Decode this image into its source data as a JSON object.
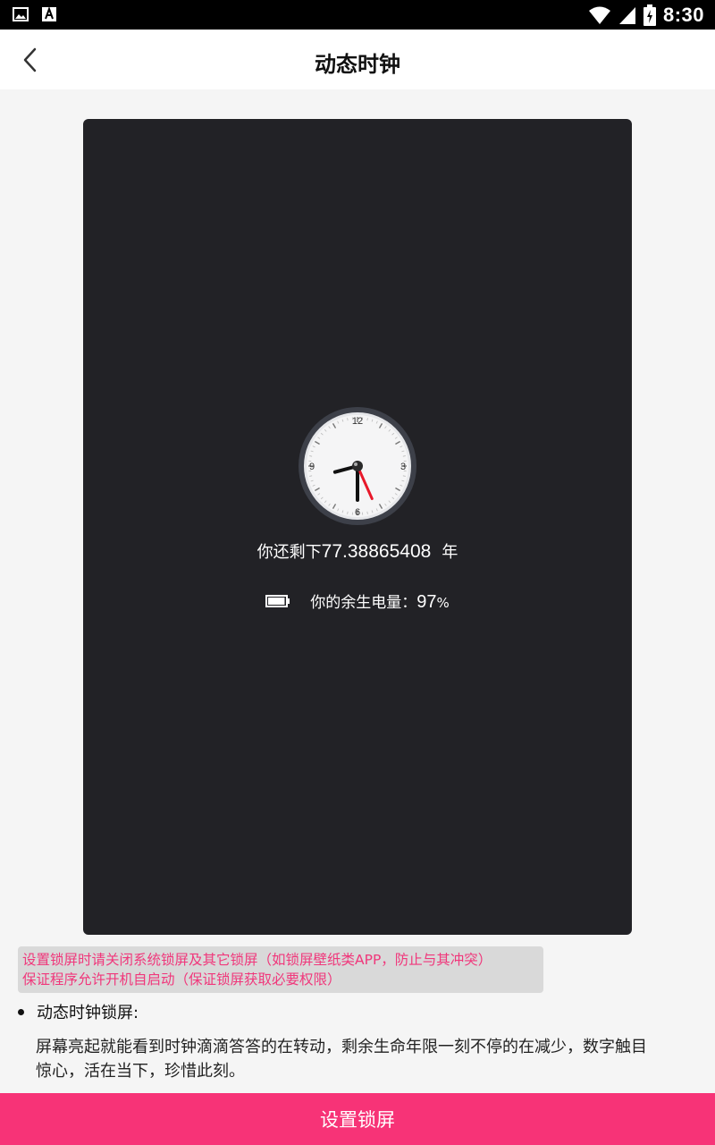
{
  "status_bar": {
    "time": "8:30",
    "left_icons": [
      "image-icon",
      "text-icon"
    ],
    "right_icons": [
      "wifi-icon",
      "signal-icon",
      "battery-charging-icon"
    ]
  },
  "app_bar": {
    "title": "动态时钟",
    "back_icon": "chevron-left-icon"
  },
  "preview": {
    "clock": {
      "numerals": [
        "12",
        "3",
        "6",
        "9"
      ],
      "hour": 8,
      "minute": 30,
      "second": 26
    },
    "remaining_prefix": "你还剩下",
    "remaining_years": "77.38865408",
    "remaining_unit": "年",
    "battery_label": "你的余生电量：",
    "battery_percent": "97",
    "battery_percent_sign": "%",
    "battery_level": 0.97
  },
  "notice": {
    "line1": "设置锁屏时请关闭系统锁屏及其它锁屏（如锁屏壁纸类APP，防止与其冲突）",
    "line2": "保证程序允许开机自启动（保证锁屏获取必要权限）"
  },
  "feature": {
    "title": "动态时钟锁屏:",
    "desc_line1": "屏幕亮起就能看到时钟滴滴答答的在转动，剩余生命年限一刻不停的在减少，数字触目",
    "desc_line2": "惊心，活在当下，珍惜此刻。"
  },
  "cta": {
    "label": "设置锁屏"
  },
  "colors": {
    "accent": "#f73377",
    "notice_text": "#f0377b",
    "preview_bg": "#222226"
  }
}
